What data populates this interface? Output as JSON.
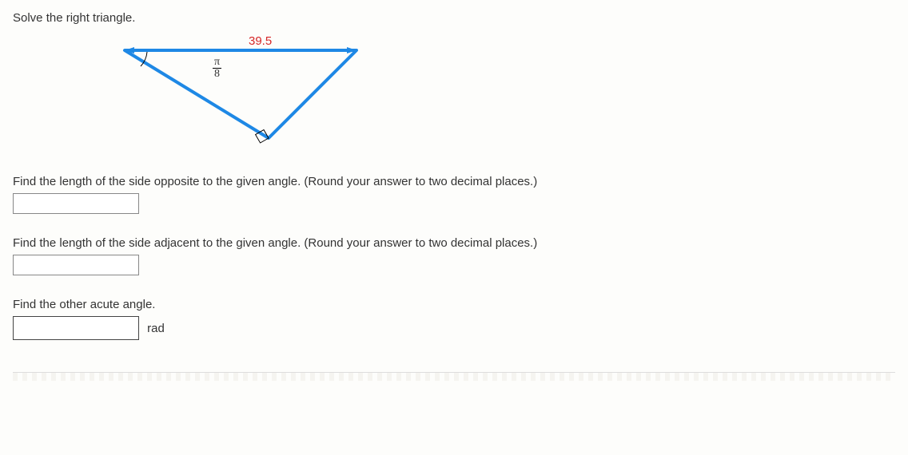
{
  "problem": {
    "title": "Solve the right triangle.",
    "figure": {
      "hypotenuse_label": "39.5",
      "given_angle_numerator": "π",
      "given_angle_denominator": "8"
    },
    "q1": {
      "text": "Find the length of the side opposite to the given angle. (Round your answer to two decimal places.)",
      "value": ""
    },
    "q2": {
      "text": "Find the length of the side adjacent to the given angle. (Round your answer to two decimal places.)",
      "value": ""
    },
    "q3": {
      "text": "Find the other acute angle.",
      "value": "",
      "unit": "rad"
    }
  }
}
